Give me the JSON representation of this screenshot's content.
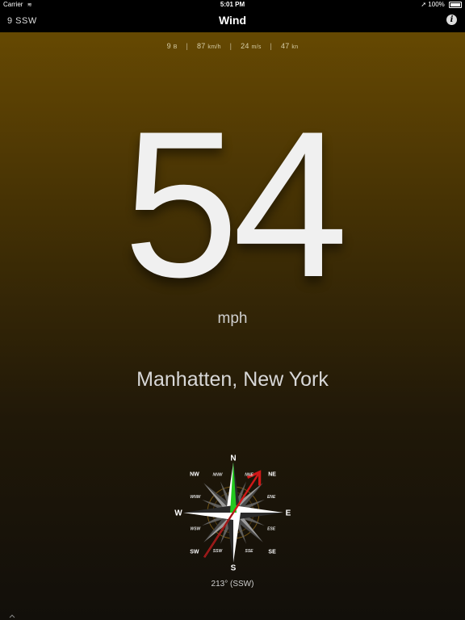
{
  "status_bar": {
    "carrier": "Carrier",
    "time": "5:01 PM",
    "battery": "100%"
  },
  "nav": {
    "left_text": "9  SSW",
    "title": "Wind",
    "info_label": "i"
  },
  "conversions": {
    "beaufort_value": "9",
    "beaufort_unit": "B",
    "kmh_value": "87",
    "kmh_unit": "km/h",
    "ms_value": "24",
    "ms_unit": "m/s",
    "kn_value": "47",
    "kn_unit": "kn",
    "separator": "|"
  },
  "wind": {
    "speed": "54",
    "unit": "mph",
    "location": "Manhatten, New York",
    "bearing_text": "213° (SSW)",
    "bearing_degrees": 213
  },
  "compass": {
    "cardinals": [
      "N",
      "E",
      "S",
      "W"
    ],
    "intercardinals": [
      "NE",
      "SE",
      "SW",
      "NW"
    ],
    "minor": [
      "NNE",
      "ENE",
      "ESE",
      "SSE",
      "SSW",
      "WSW",
      "WNW",
      "NNW"
    ],
    "north_color": "#22c81e",
    "arrow_color": "#d01818"
  }
}
